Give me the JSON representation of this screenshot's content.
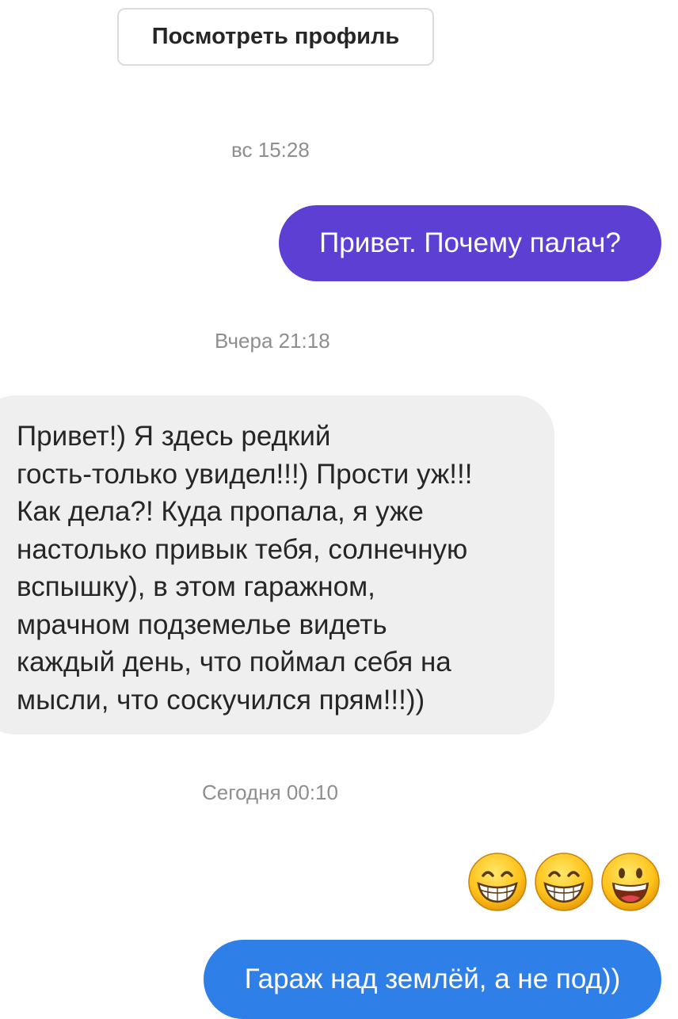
{
  "header": {
    "view_profile_label": "Посмотреть профиль"
  },
  "thread": {
    "timestamps": [
      "вс 15:28",
      "Вчера 21:18",
      "Сегодня 00:10"
    ],
    "messages": [
      {
        "from": "me",
        "text": "Привет. Почему палач?"
      },
      {
        "from": "them",
        "lines": [
          "Привет!) Я здесь редкий",
          "гость-только увидел!!!) Прости уж!!!",
          "Как дела?! Куда пропала, я уже",
          "настолько привык тебя, солнечную",
          "вспышку), в этом гаражном,",
          "мрачном подземелье видеть",
          "каждый день, что поймал себя на",
          "мысли, что соскучился прям!!!))"
        ]
      },
      {
        "from": "me",
        "emojis": [
          "grinning-face-with-smiling-eyes",
          "grinning-face-with-smiling-eyes",
          "grinning-face"
        ]
      },
      {
        "from": "me",
        "text": "Гараж над землёй, а не под))"
      }
    ]
  },
  "colors": {
    "outgoing_purple": "#5e3fd4",
    "outgoing_blue": "#2f7fe9",
    "incoming_bg": "#efefef",
    "timestamp_text": "#8e8e8e"
  }
}
